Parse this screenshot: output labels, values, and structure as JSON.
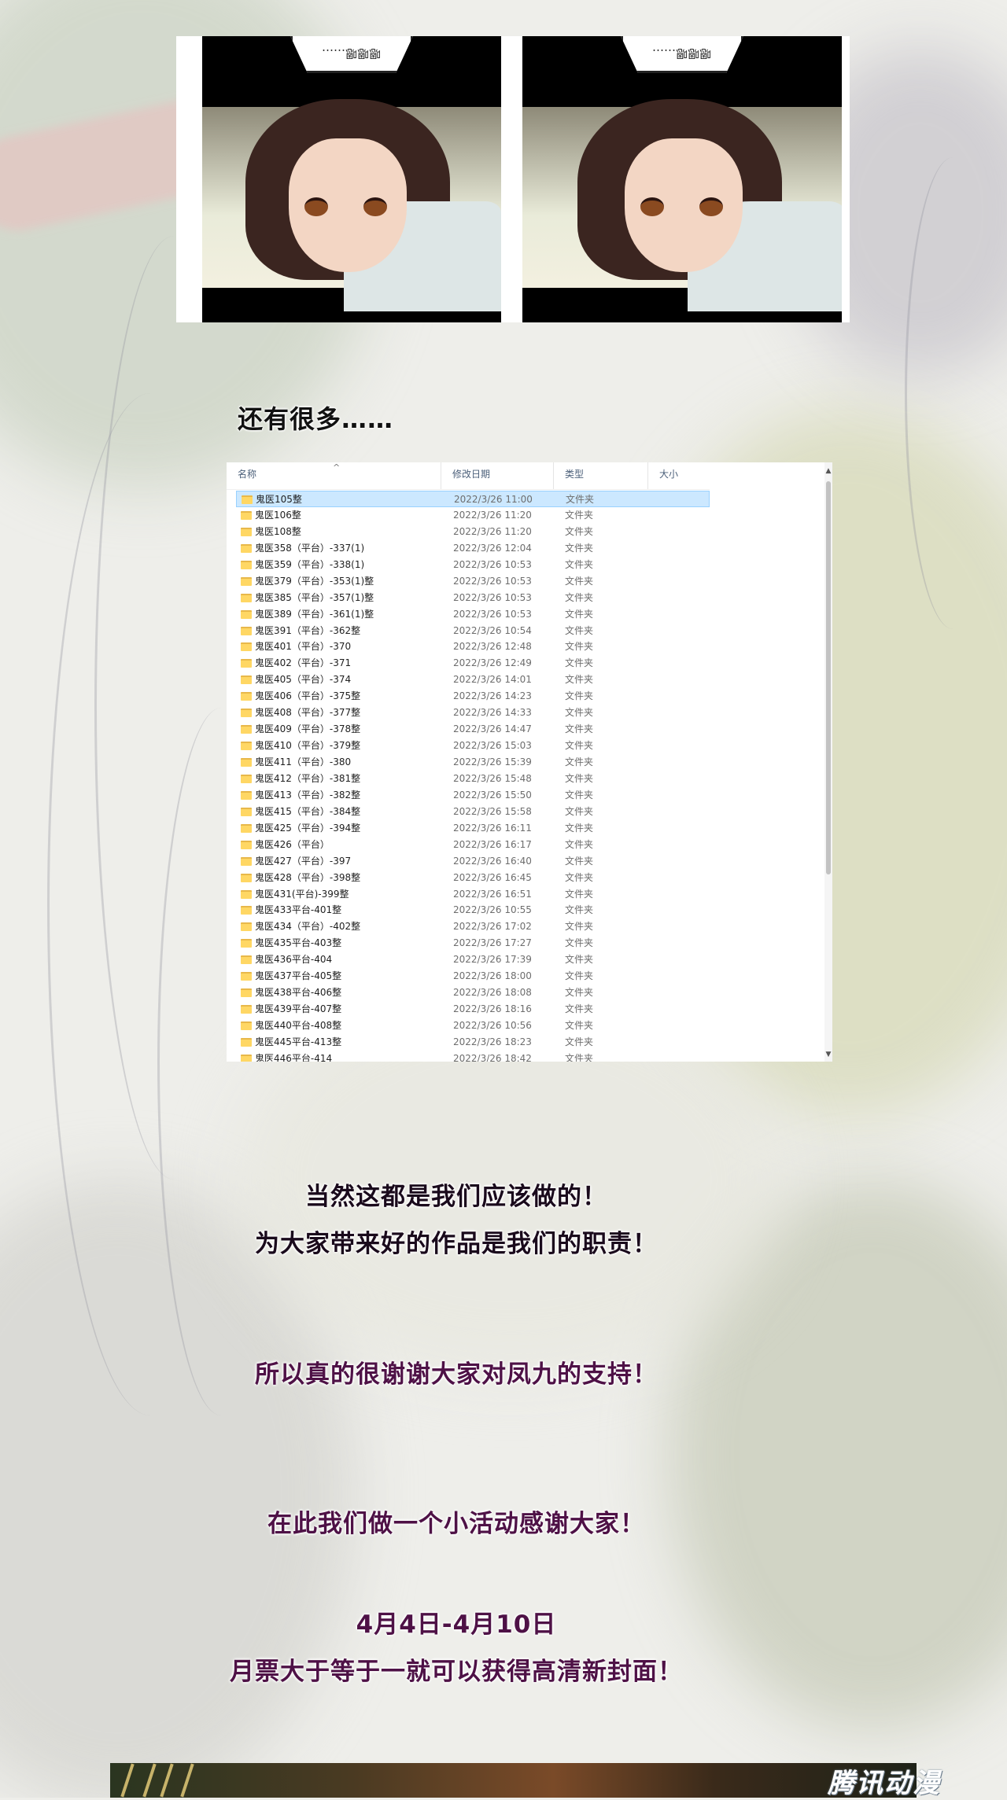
{
  "top_panels": {
    "bubble_text_1": "嗯嗯嗯……",
    "bubble_text_2": "嗯嗯嗯……"
  },
  "caption": "还有很多……",
  "explorer": {
    "columns": {
      "name": "名称",
      "modified": "修改日期",
      "type": "类型",
      "size": "大小"
    },
    "rows": [
      {
        "name": "鬼医105整",
        "date": "2022/3/26 11:00",
        "type": "文件夹"
      },
      {
        "name": "鬼医106整",
        "date": "2022/3/26 11:20",
        "type": "文件夹"
      },
      {
        "name": "鬼医108整",
        "date": "2022/3/26 11:20",
        "type": "文件夹"
      },
      {
        "name": "鬼医358（平台）-337(1)",
        "date": "2022/3/26 12:04",
        "type": "文件夹"
      },
      {
        "name": "鬼医359（平台）-338(1)",
        "date": "2022/3/26 10:53",
        "type": "文件夹"
      },
      {
        "name": "鬼医379（平台）-353(1)整",
        "date": "2022/3/26 10:53",
        "type": "文件夹"
      },
      {
        "name": "鬼医385（平台）-357(1)整",
        "date": "2022/3/26 10:53",
        "type": "文件夹"
      },
      {
        "name": "鬼医389（平台）-361(1)整",
        "date": "2022/3/26 10:53",
        "type": "文件夹"
      },
      {
        "name": "鬼医391（平台）-362整",
        "date": "2022/3/26 10:54",
        "type": "文件夹"
      },
      {
        "name": "鬼医401（平台）-370",
        "date": "2022/3/26 12:48",
        "type": "文件夹"
      },
      {
        "name": "鬼医402（平台）-371",
        "date": "2022/3/26 12:49",
        "type": "文件夹"
      },
      {
        "name": "鬼医405（平台）-374",
        "date": "2022/3/26 14:01",
        "type": "文件夹"
      },
      {
        "name": "鬼医406（平台）-375整",
        "date": "2022/3/26 14:23",
        "type": "文件夹"
      },
      {
        "name": "鬼医408（平台）-377整",
        "date": "2022/3/26 14:33",
        "type": "文件夹"
      },
      {
        "name": "鬼医409（平台）-378整",
        "date": "2022/3/26 14:47",
        "type": "文件夹"
      },
      {
        "name": "鬼医410（平台）-379整",
        "date": "2022/3/26 15:03",
        "type": "文件夹"
      },
      {
        "name": "鬼医411（平台）-380",
        "date": "2022/3/26 15:39",
        "type": "文件夹"
      },
      {
        "name": "鬼医412（平台）-381整",
        "date": "2022/3/26 15:48",
        "type": "文件夹"
      },
      {
        "name": "鬼医413（平台）-382整",
        "date": "2022/3/26 15:50",
        "type": "文件夹"
      },
      {
        "name": "鬼医415（平台）-384整",
        "date": "2022/3/26 15:58",
        "type": "文件夹"
      },
      {
        "name": "鬼医425（平台）-394整",
        "date": "2022/3/26 16:11",
        "type": "文件夹"
      },
      {
        "name": "鬼医426（平台）",
        "date": "2022/3/26 16:17",
        "type": "文件夹"
      },
      {
        "name": "鬼医427（平台）-397",
        "date": "2022/3/26 16:40",
        "type": "文件夹"
      },
      {
        "name": "鬼医428（平台）-398整",
        "date": "2022/3/26 16:45",
        "type": "文件夹"
      },
      {
        "name": "鬼医431(平台)-399整",
        "date": "2022/3/26 16:51",
        "type": "文件夹"
      },
      {
        "name": "鬼医433平台-401整",
        "date": "2022/3/26 10:55",
        "type": "文件夹"
      },
      {
        "name": "鬼医434（平台）-402整",
        "date": "2022/3/26 17:02",
        "type": "文件夹"
      },
      {
        "name": "鬼医435平台-403整",
        "date": "2022/3/26 17:27",
        "type": "文件夹"
      },
      {
        "name": "鬼医436平台-404",
        "date": "2022/3/26 17:39",
        "type": "文件夹"
      },
      {
        "name": "鬼医437平台-405整",
        "date": "2022/3/26 18:00",
        "type": "文件夹"
      },
      {
        "name": "鬼医438平台-406整",
        "date": "2022/3/26 18:08",
        "type": "文件夹"
      },
      {
        "name": "鬼医439平台-407整",
        "date": "2022/3/26 18:16",
        "type": "文件夹"
      },
      {
        "name": "鬼医440平台-408整",
        "date": "2022/3/26 10:56",
        "type": "文件夹"
      },
      {
        "name": "鬼医445平台-413整",
        "date": "2022/3/26 18:23",
        "type": "文件夹"
      },
      {
        "name": "鬼医446平台-414",
        "date": "2022/3/26 18:42",
        "type": "文件夹"
      }
    ]
  },
  "messages": {
    "line1": "当然这都是我们应该做的！",
    "line2": "为大家带来好的作品是我们的职责！",
    "line3": "所以真的很谢谢大家对凤九的支持！",
    "line4": "在此我们做一个小活动感谢大家！",
    "line5": "4月4日-4月10日",
    "line6": "月票大于等于一就可以获得高清新封面！"
  },
  "watermark": "腾讯动漫",
  "colors": {
    "selection": "#cce8ff",
    "folder": "#ffd764",
    "purple_text": "#4e1146"
  }
}
